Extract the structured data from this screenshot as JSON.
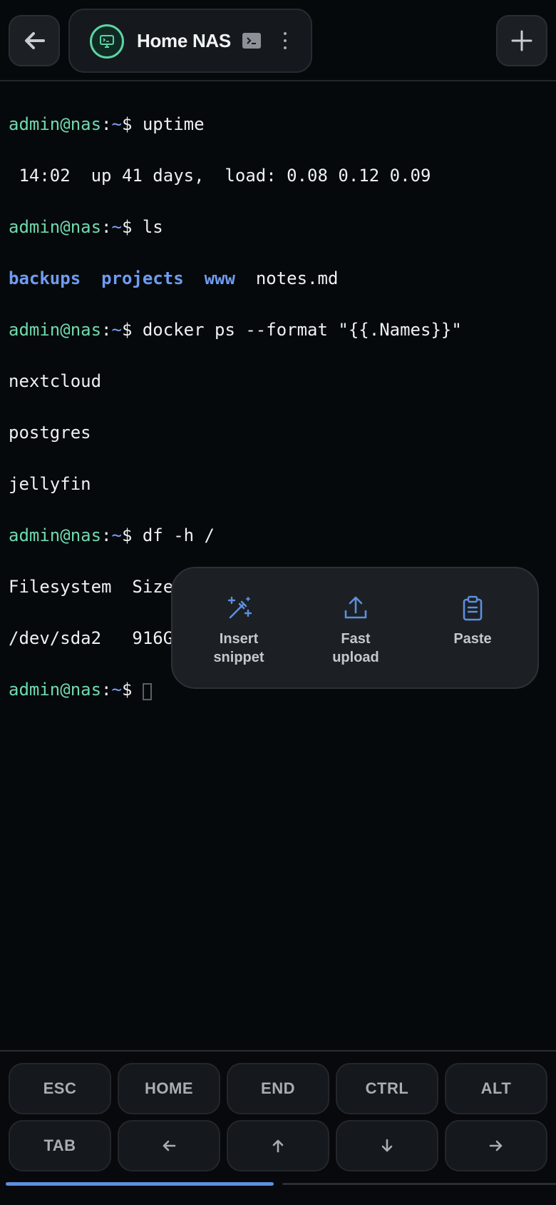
{
  "header": {
    "back_icon": "arrow-left-icon",
    "session_title": "Home NAS",
    "session_avatar_icon": "monitor-terminal-icon",
    "session_type_icon": "terminal-icon",
    "menu_icon": "more-vertical-icon",
    "add_icon": "plus-icon"
  },
  "terminal": {
    "prompt": {
      "user": "admin@nas",
      "colon": ":",
      "path": "~",
      "dollar": "$ "
    },
    "cmd_uptime": "uptime",
    "out_uptime": " 14:02  up 41 days,  load: 0.08 0.12 0.09",
    "cmd_ls": "ls",
    "ls_dirs": [
      "backups",
      "projects",
      "www"
    ],
    "ls_file": "notes.md",
    "cmd_docker": "docker ps --format \"{{.Names}}\"",
    "docker_out": [
      "nextcloud",
      "postgres",
      "jellyfin"
    ],
    "cmd_df": "df -h /",
    "df_header": "Filesystem  Size  Used Avail Use% Mounted",
    "df_row": "/dev/sda2   916G  402G  468G  47% /"
  },
  "popup": {
    "items": [
      {
        "icon": "magic-wand-icon",
        "label": "Insert\nsnippet"
      },
      {
        "icon": "upload-icon",
        "label": "Fast\nupload"
      },
      {
        "icon": "clipboard-icon",
        "label": "Paste"
      }
    ]
  },
  "keys": {
    "row1": [
      "ESC",
      "HOME",
      "END",
      "CTRL",
      "ALT"
    ],
    "row2_first": "TAB",
    "arrow_icons": [
      "arrow-left-icon",
      "arrow-up-icon",
      "arrow-down-icon",
      "arrow-right-icon"
    ]
  },
  "pager": {
    "progress": 0.5
  },
  "colors": {
    "accent": "#6f9cf0",
    "prompt_green": "#6fd9ad",
    "background": "#06090c"
  }
}
